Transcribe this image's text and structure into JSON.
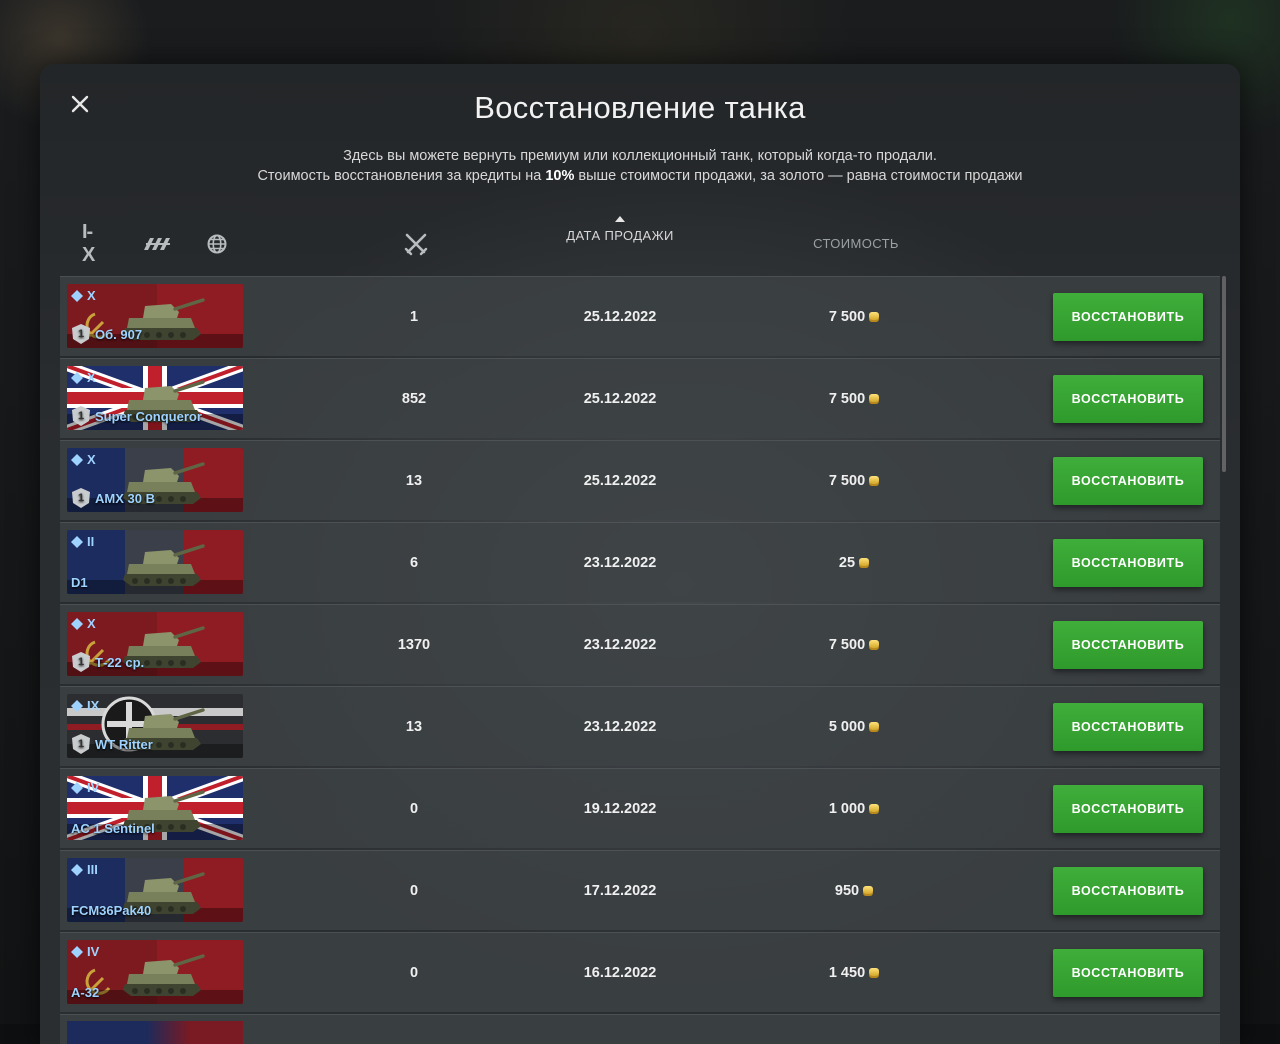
{
  "modal": {
    "title": "Восстановление танка",
    "subtitle_line1": "Здесь вы можете вернуть премиум или коллекционный танк, который когда-то продали.",
    "subtitle_line2_pre": "Стоимость восстановления за кредиты на ",
    "subtitle_line2_bold": "10%",
    "subtitle_line2_post": " выше стоимости продажи, за золото — равна стоимости продажи"
  },
  "filters": {
    "tier_label": "I-X",
    "type_icon": "vehicle-type-icon",
    "nation_icon": "globe-icon"
  },
  "columns": {
    "battles_icon": "crossed-swords-icon",
    "date": "ДАТА ПРОДАЖИ",
    "cost": "СТОИМОСТЬ",
    "sort": "descending"
  },
  "colors": {
    "accent_green": "#35a531",
    "tank_name_blue": "#9fd3ff",
    "gold": "#f2c230"
  },
  "rows": [
    {
      "tier": "X",
      "name": "Об. 907",
      "flag": "ussr",
      "mastery": "1",
      "battles": "1",
      "date": "25.12.2022",
      "cost": "7 500",
      "button": "ВОССТАНОВИТЬ"
    },
    {
      "tier": "X",
      "name": "Super Conqueror",
      "flag": "uk",
      "mastery": "1",
      "battles": "852",
      "date": "25.12.2022",
      "cost": "7 500",
      "button": "ВОССТАНОВИТЬ"
    },
    {
      "tier": "X",
      "name": "AMX 30 B",
      "flag": "france",
      "mastery": "1",
      "battles": "13",
      "date": "25.12.2022",
      "cost": "7 500",
      "button": "ВОССТАНОВИТЬ"
    },
    {
      "tier": "II",
      "name": "D1",
      "flag": "france",
      "mastery": "",
      "battles": "6",
      "date": "23.12.2022",
      "cost": "25",
      "button": "ВОССТАНОВИТЬ"
    },
    {
      "tier": "X",
      "name": "Т-22 ср.",
      "flag": "ussr",
      "mastery": "1",
      "battles": "1370",
      "date": "23.12.2022",
      "cost": "7 500",
      "button": "ВОССТАНОВИТЬ"
    },
    {
      "tier": "IX",
      "name": "WT Ritter",
      "flag": "germany",
      "mastery": "1",
      "battles": "13",
      "date": "23.12.2022",
      "cost": "5 000",
      "button": "ВОССТАНОВИТЬ"
    },
    {
      "tier": "IV",
      "name": "AC 1 Sentinel",
      "flag": "uk",
      "mastery": "",
      "battles": "0",
      "date": "19.12.2022",
      "cost": "1 000",
      "button": "ВОССТАНОВИТЬ"
    },
    {
      "tier": "III",
      "name": "FCM36Pak40",
      "flag": "france",
      "mastery": "",
      "battles": "0",
      "date": "17.12.2022",
      "cost": "950",
      "button": "ВОССТАНОВИТЬ"
    },
    {
      "tier": "IV",
      "name": "A-32",
      "flag": "ussr",
      "mastery": "",
      "battles": "0",
      "date": "16.12.2022",
      "cost": "1 450",
      "button": "ВОССТАНОВИТЬ"
    }
  ]
}
